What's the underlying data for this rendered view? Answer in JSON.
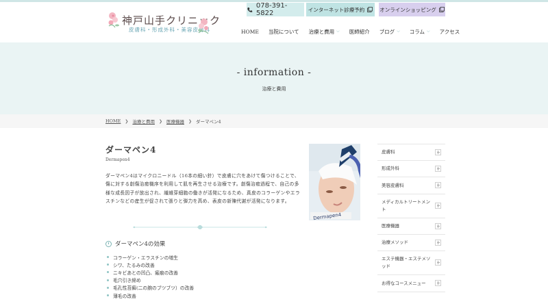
{
  "header": {
    "clinic_name": "神戸山手クリニック",
    "clinic_sub": "皮膚科・形成外科・美容皮膚科",
    "phone": "078-391-5822",
    "reserve_label": "インターネット診療予約",
    "shop_label": "オンラインショッピング",
    "nav": [
      {
        "label": "HOME",
        "has_menu": false
      },
      {
        "label": "当院について",
        "has_menu": false
      },
      {
        "label": "治療と費用",
        "has_menu": true
      },
      {
        "label": "医師紹介",
        "has_menu": false
      },
      {
        "label": "ブログ",
        "has_menu": true
      },
      {
        "label": "コラム",
        "has_menu": true
      },
      {
        "label": "アクセス",
        "has_menu": false
      }
    ],
    "icons": {
      "phone": "phone-icon",
      "external": "external-link-icon",
      "chevron": "chevron-down-icon"
    }
  },
  "hero": {
    "title": "- information -",
    "subtitle": "治療と費用"
  },
  "breadcrumb": {
    "items": [
      "HOME",
      "治療と費用",
      "医療機器",
      "ダーマペン4"
    ]
  },
  "article": {
    "title": "ダーマペン4",
    "title_en": "Dermapen4",
    "body": "ダーマペン4はマイクロニードル（16本の細い針）で皮膚に穴をあけて傷つけることで、傷に対する創傷治癒機序を利用して肌を再生させる治療です。創傷治癒過程で、自己の多様な成長因子が放出され、繊維芽細胞の働きが活発になるため、真皮のコラーゲンやエラスチンなどの産生が促されて張りと弾力を高め、表皮の新陳代謝が活発になります。",
    "effects_title": "ダーマペン4の効果",
    "effects": [
      "コラーゲン・エラスチンの増生",
      "シワ、たるみの改善",
      "ニキビあとの凹凸、瘢痕の改善",
      "毛穴引き締め",
      "毛孔性苔癬(二の腕のブツブツ）の改善",
      "薄毛の改善"
    ],
    "photo_text": "Dermapen4"
  },
  "sidebar": {
    "items": [
      "皮膚科",
      "形成外科",
      "美容皮膚科",
      "メディカルトリートメント",
      "医療機器",
      "治療メソッド",
      "エステ機器・エステメソッド",
      "お得なコースメニュー"
    ]
  },
  "colors": {
    "accent_teal": "#bfe3e3",
    "accent_lavender": "#d8cfee",
    "hero_bg": "#eaf4f4"
  }
}
